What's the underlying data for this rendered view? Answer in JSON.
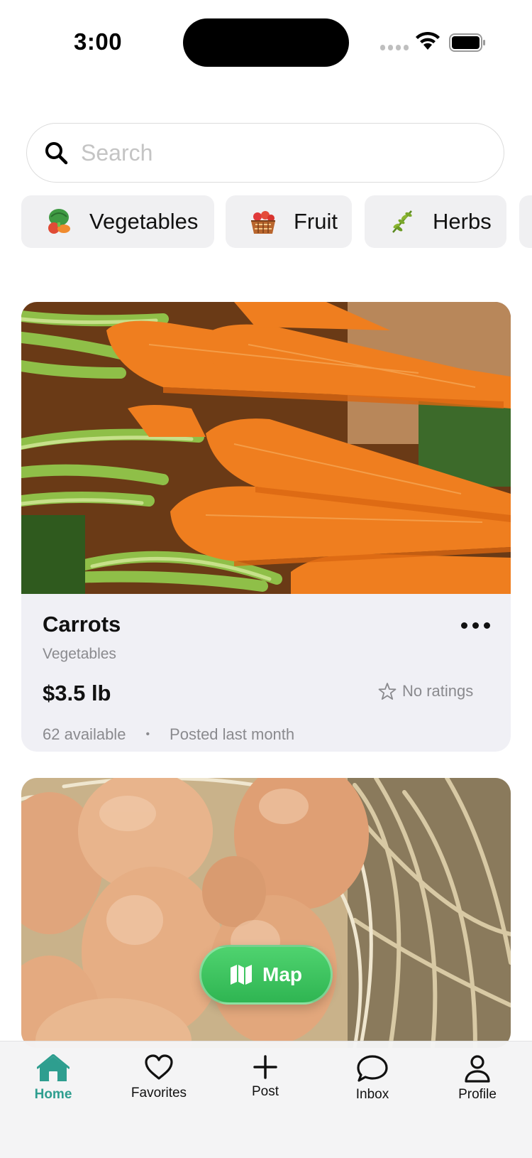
{
  "status_bar": {
    "time": "3:00"
  },
  "search": {
    "placeholder": "Search"
  },
  "categories": [
    {
      "label": "Vegetables",
      "icon": "vegetables-icon"
    },
    {
      "label": "Fruit",
      "icon": "fruit-basket-icon"
    },
    {
      "label": "Herbs",
      "icon": "herbs-icon"
    }
  ],
  "listings": [
    {
      "title": "Carrots",
      "category": "Vegetables",
      "price": "$3.5 lb",
      "rating": "No ratings",
      "available": "62 available",
      "separator": "•",
      "posted": "Posted last month",
      "image": "carrots-photo"
    },
    {
      "image": "eggs-photo"
    }
  ],
  "map_button": {
    "label": "Map"
  },
  "tabbar": {
    "items": [
      {
        "label": "Home",
        "icon": "home-icon",
        "active": true
      },
      {
        "label": "Favorites",
        "icon": "heart-icon"
      },
      {
        "label": "Post",
        "icon": "plus-icon"
      },
      {
        "label": "Inbox",
        "icon": "chat-bubble-icon"
      },
      {
        "label": "Profile",
        "icon": "person-icon"
      }
    ]
  },
  "colors": {
    "accent": "#2e9e8f",
    "map_button": "#35bd58",
    "card_background": "#f0f0f5",
    "chip_background": "#f0f0f2"
  }
}
